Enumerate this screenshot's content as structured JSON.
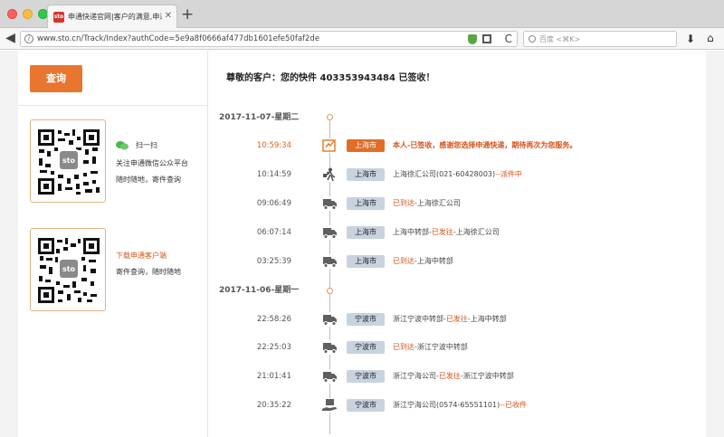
{
  "browser": {
    "tab_title": "申通快递官网|客户的满意,申通",
    "tab_close": "✕",
    "new_tab": "+",
    "back": "◀",
    "url": "www.sto.cn/Track/Index?authCode=5e9a8f0666af477db1601efe50faf2de",
    "search_placeholder": "百度 <⌘K>",
    "reload": "C",
    "download": "⬇",
    "home": "⌂"
  },
  "sidebar": {
    "query_button": "查询",
    "wechat_scan": "扫一扫",
    "wechat_follow": "关注申通微信公众平台",
    "wechat_anytime": "随时随地，寄件查询",
    "app_download": "下载申通客户端",
    "app_desc": "寄件查询，随时随地"
  },
  "tracking": {
    "headline": "尊敬的客户：您的快件 403353943484 已签收！",
    "groups": [
      {
        "date": "2017-11-07-星期二",
        "events": [
          {
            "time": "10:59:34",
            "icon": "sign-icon",
            "city": "上海市",
            "desc": "本人-已签收，感谢您选择申通快递，期待再次为您服务。",
            "active": true
          },
          {
            "time": "10:14:59",
            "icon": "courier-icon",
            "city": "上海市",
            "desc_a": "上海徐汇公司(021-60428003)",
            "desc_hl": "--派件中",
            "desc_b": "",
            "active": false
          },
          {
            "time": "09:06:49",
            "icon": "truck-icon",
            "city": "上海市",
            "desc_a": "",
            "desc_hl": "已到达",
            "desc_b": "-上海徐汇公司",
            "active": false
          },
          {
            "time": "06:07:14",
            "icon": "truck-icon",
            "city": "上海市",
            "desc_a": "上海中转部-",
            "desc_hl": "已发往",
            "desc_b": "-上海徐汇公司",
            "active": false
          },
          {
            "time": "03:25:39",
            "icon": "truck-icon",
            "city": "上海市",
            "desc_a": "",
            "desc_hl": "已到达",
            "desc_b": "-上海中转部",
            "active": false
          }
        ]
      },
      {
        "date": "2017-11-06-星期一",
        "events": [
          {
            "time": "22:58:26",
            "icon": "truck-icon",
            "city": "宁波市",
            "desc_a": "浙江宁波中转部-",
            "desc_hl": "已发往",
            "desc_b": "-上海中转部",
            "active": false
          },
          {
            "time": "22:25:03",
            "icon": "truck-icon",
            "city": "宁波市",
            "desc_a": "",
            "desc_hl": "已到达",
            "desc_b": "-浙江宁波中转部",
            "active": false
          },
          {
            "time": "21:01:41",
            "icon": "truck-icon",
            "city": "宁波市",
            "desc_a": "浙江宁海公司-",
            "desc_hl": "已发往",
            "desc_b": "-浙江宁波中转部",
            "active": false
          },
          {
            "time": "20:35:22",
            "icon": "pickup-icon",
            "city": "宁波市",
            "desc_a": "浙江宁海公司(0574-65551101)",
            "desc_hl": "--已收件",
            "desc_b": "",
            "active": false
          }
        ]
      }
    ]
  },
  "colors": {
    "accent": "#e8762e",
    "highlight_text": "#d6531a",
    "city_badge": "#c8d3de",
    "wechat_green": "#4cb84c"
  }
}
